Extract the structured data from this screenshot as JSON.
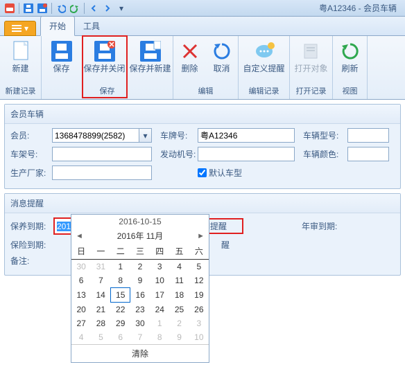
{
  "title": "粤A12346 - 会员车辆",
  "tabs": {
    "start": "开始",
    "tools": "工具"
  },
  "ribbon": {
    "new": "新建",
    "save": "保存",
    "saveclose": "保存并关闭",
    "savenew": "保存并新建",
    "delete": "删除",
    "cancel": "取消",
    "remind": "自定义提醒",
    "open": "打开对象",
    "refresh": "刷新",
    "g1": "新建记录",
    "g2": "保存",
    "g3": "编辑",
    "g4": "编辑记录",
    "g5": "打开记录",
    "g6": "视图"
  },
  "panel1": {
    "title": "会员车辆",
    "member_lbl": "会员:",
    "member_val": "1368478899(2582)",
    "plate_lbl": "车牌号:",
    "plate_val": "粤A12346",
    "model_lbl": "车辆型号:",
    "model_val": "",
    "vin_lbl": "车架号:",
    "vin_val": "",
    "engine_lbl": "发动机号:",
    "engine_val": "",
    "color_lbl": "车辆颜色:",
    "color_val": "",
    "maker_lbl": "生产厂家:",
    "maker_val": "",
    "default_chk": "默认车型"
  },
  "panel2": {
    "title": "消息提醒",
    "maint_lbl": "保养到期:",
    "maint_val": "2016-11-15",
    "maint_chk": "保养到期提醒",
    "annual_lbl": "年审到期:",
    "ins_lbl": "保险到期:",
    "ins_chk_tail": "醒",
    "remark_lbl": "备注:"
  },
  "dp": {
    "date": "2016-10-15",
    "month": "2016年 11月",
    "clear": "清除",
    "dow": [
      "日",
      "一",
      "二",
      "三",
      "四",
      "五",
      "六"
    ],
    "cells": [
      [
        {
          "d": "30",
          "o": 1
        },
        {
          "d": "31",
          "o": 1
        },
        {
          "d": "1"
        },
        {
          "d": "2"
        },
        {
          "d": "3"
        },
        {
          "d": "4"
        },
        {
          "d": "5"
        }
      ],
      [
        {
          "d": "6"
        },
        {
          "d": "7"
        },
        {
          "d": "8"
        },
        {
          "d": "9"
        },
        {
          "d": "10"
        },
        {
          "d": "11"
        },
        {
          "d": "12"
        }
      ],
      [
        {
          "d": "13"
        },
        {
          "d": "14"
        },
        {
          "d": "15",
          "s": 1
        },
        {
          "d": "16"
        },
        {
          "d": "17"
        },
        {
          "d": "18"
        },
        {
          "d": "19"
        }
      ],
      [
        {
          "d": "20"
        },
        {
          "d": "21"
        },
        {
          "d": "22"
        },
        {
          "d": "23"
        },
        {
          "d": "24"
        },
        {
          "d": "25"
        },
        {
          "d": "26"
        }
      ],
      [
        {
          "d": "27"
        },
        {
          "d": "28"
        },
        {
          "d": "29"
        },
        {
          "d": "30"
        },
        {
          "d": "1",
          "o": 1
        },
        {
          "d": "2",
          "o": 1
        },
        {
          "d": "3",
          "o": 1
        }
      ],
      [
        {
          "d": "4",
          "o": 1
        },
        {
          "d": "5",
          "o": 1
        },
        {
          "d": "6",
          "o": 1
        },
        {
          "d": "7",
          "o": 1
        },
        {
          "d": "8",
          "o": 1
        },
        {
          "d": "9",
          "o": 1
        },
        {
          "d": "10",
          "o": 1
        }
      ]
    ]
  }
}
